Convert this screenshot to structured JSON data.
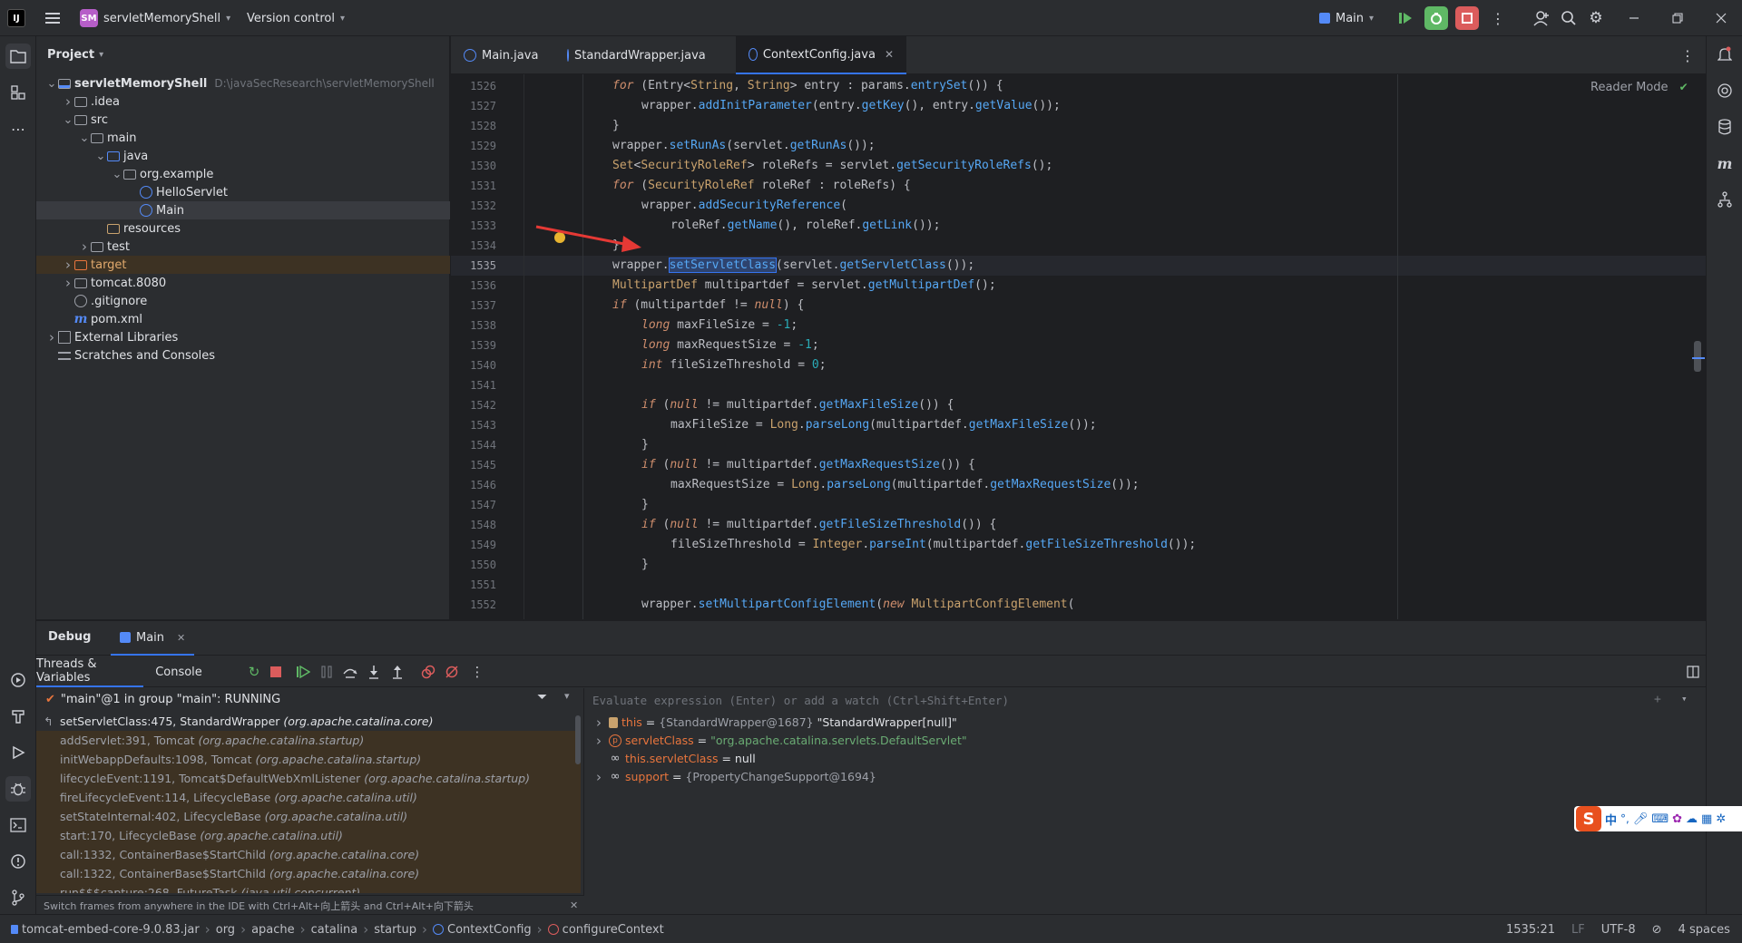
{
  "titlebar": {
    "app_badge": "SM",
    "project_name": "servletMemoryShell",
    "vcs_label": "Version control",
    "run_config": "Main"
  },
  "project_panel": {
    "title": "Project",
    "tree": [
      {
        "label": "servletMemoryShell",
        "path": "D:\\javaSecResearch\\servletMemoryShell",
        "depth": 0,
        "icon": "module-folder-icon",
        "expanded": true
      },
      {
        "label": ".idea",
        "depth": 1,
        "icon": "folder-icon",
        "expanded": false
      },
      {
        "label": "src",
        "depth": 1,
        "icon": "folder-icon",
        "expanded": true
      },
      {
        "label": "main",
        "depth": 2,
        "icon": "folder-icon",
        "expanded": true
      },
      {
        "label": "java",
        "depth": 3,
        "icon": "source-folder-icon",
        "expanded": true
      },
      {
        "label": "org.example",
        "depth": 4,
        "icon": "package-icon",
        "expanded": true
      },
      {
        "label": "HelloServlet",
        "depth": 5,
        "icon": "class-icon"
      },
      {
        "label": "Main",
        "depth": 5,
        "icon": "class-icon",
        "selected": true
      },
      {
        "label": "resources",
        "depth": 3,
        "icon": "resources-folder-icon"
      },
      {
        "label": "test",
        "depth": 2,
        "icon": "folder-icon",
        "expanded": false
      },
      {
        "label": "target",
        "depth": 1,
        "icon": "excluded-folder-icon",
        "expanded": false,
        "highlight": true
      },
      {
        "label": "tomcat.8080",
        "depth": 1,
        "icon": "folder-icon",
        "expanded": false
      },
      {
        "label": ".gitignore",
        "depth": 1,
        "icon": "ignore-file-icon"
      },
      {
        "label": "pom.xml",
        "depth": 1,
        "icon": "maven-icon"
      },
      {
        "label": "External Libraries",
        "depth": 0,
        "icon": "libraries-icon",
        "expanded": false
      },
      {
        "label": "Scratches and Consoles",
        "depth": 0,
        "icon": "scratches-icon"
      }
    ]
  },
  "editor": {
    "tabs": [
      {
        "label": "Main.java",
        "active": false
      },
      {
        "label": "StandardWrapper.java",
        "active": false
      },
      {
        "label": "ContextConfig.java",
        "active": true
      }
    ],
    "reader_mode": "Reader Mode",
    "lines": [
      {
        "n": "1526",
        "indent": 0
      },
      {
        "n": "1527",
        "indent": 1
      },
      {
        "n": "1528",
        "indent": 0
      },
      {
        "n": "1529",
        "indent": 0
      },
      {
        "n": "1530",
        "indent": 0
      },
      {
        "n": "1531",
        "indent": 0
      },
      {
        "n": "1532",
        "indent": 1
      },
      {
        "n": "1533",
        "indent": 2
      },
      {
        "n": "1534",
        "indent": 0
      },
      {
        "n": "1535",
        "indent": 0,
        "current": true
      },
      {
        "n": "1536",
        "indent": 0
      },
      {
        "n": "1537",
        "indent": 0
      },
      {
        "n": "1538",
        "indent": 1
      },
      {
        "n": "1539",
        "indent": 1
      },
      {
        "n": "1540",
        "indent": 1
      },
      {
        "n": "1541",
        "indent": 0
      },
      {
        "n": "1542",
        "indent": 1
      },
      {
        "n": "1543",
        "indent": 2
      },
      {
        "n": "1544",
        "indent": 1
      },
      {
        "n": "1545",
        "indent": 1
      },
      {
        "n": "1546",
        "indent": 2
      },
      {
        "n": "1547",
        "indent": 1
      },
      {
        "n": "1548",
        "indent": 1
      },
      {
        "n": "1549",
        "indent": 2
      },
      {
        "n": "1550",
        "indent": 1
      },
      {
        "n": "1551",
        "indent": 0
      },
      {
        "n": "1552",
        "indent": 1
      }
    ],
    "code": [
      [
        [
          "kwi",
          "for"
        ],
        [
          "ty",
          " (Entry<"
        ],
        [
          "cls",
          "String"
        ],
        [
          "ty",
          ", "
        ],
        [
          "cls",
          "String"
        ],
        [
          "ty",
          "> entry : params."
        ],
        [
          "fn",
          "entrySet"
        ],
        [
          "ty",
          "()) {"
        ]
      ],
      [
        [
          "ty",
          "wrapper."
        ],
        [
          "fn",
          "addInitParameter"
        ],
        [
          "ty",
          "(entry."
        ],
        [
          "fn",
          "getKey"
        ],
        [
          "ty",
          "(), entry."
        ],
        [
          "fn",
          "getValue"
        ],
        [
          "ty",
          "());"
        ]
      ],
      [
        [
          "ty",
          "}"
        ]
      ],
      [
        [
          "ty",
          "wrapper."
        ],
        [
          "fn",
          "setRunAs"
        ],
        [
          "ty",
          "(servlet."
        ],
        [
          "fn",
          "getRunAs"
        ],
        [
          "ty",
          "());"
        ]
      ],
      [
        [
          "cls",
          "Set"
        ],
        [
          "ty",
          "<"
        ],
        [
          "cls",
          "SecurityRoleRef"
        ],
        [
          "ty",
          "> roleRefs = servlet."
        ],
        [
          "fn",
          "getSecurityRoleRefs"
        ],
        [
          "ty",
          "();"
        ]
      ],
      [
        [
          "kwi",
          "for"
        ],
        [
          "ty",
          " ("
        ],
        [
          "cls",
          "SecurityRoleRef"
        ],
        [
          "ty",
          " roleRef : roleRefs) {"
        ]
      ],
      [
        [
          "ty",
          "wrapper."
        ],
        [
          "fn",
          "addSecurityReference"
        ],
        [
          "ty",
          "("
        ]
      ],
      [
        [
          "ty",
          "roleRef."
        ],
        [
          "fn",
          "getName"
        ],
        [
          "ty",
          "(), roleRef."
        ],
        [
          "fn",
          "getLink"
        ],
        [
          "ty",
          "());"
        ]
      ],
      [
        [
          "ty",
          "}"
        ]
      ],
      [
        [
          "ty",
          "wrapper."
        ],
        [
          "fn",
          "setServletClass"
        ],
        [
          "ty",
          "(servlet."
        ],
        [
          "fn",
          "getServletClass"
        ],
        [
          "ty",
          "());"
        ]
      ],
      [
        [
          "cls",
          "MultipartDef"
        ],
        [
          "ty",
          " multipartdef = servlet."
        ],
        [
          "fn",
          "getMultipartDef"
        ],
        [
          "ty",
          "();"
        ]
      ],
      [
        [
          "kwi",
          "if"
        ],
        [
          "ty",
          " (multipartdef != "
        ],
        [
          "kwi",
          "null"
        ],
        [
          "ty",
          ") {"
        ]
      ],
      [
        [
          "kwi",
          "long"
        ],
        [
          "ty",
          " maxFileSize = "
        ],
        [
          "num",
          "-1"
        ],
        [
          "ty",
          ";"
        ]
      ],
      [
        [
          "kwi",
          "long"
        ],
        [
          "ty",
          " maxRequestSize = "
        ],
        [
          "num",
          "-1"
        ],
        [
          "ty",
          ";"
        ]
      ],
      [
        [
          "kwi",
          "int"
        ],
        [
          "ty",
          " fileSizeThreshold = "
        ],
        [
          "num",
          "0"
        ],
        [
          "ty",
          ";"
        ]
      ],
      [],
      [
        [
          "kwi",
          "if"
        ],
        [
          "ty",
          " ("
        ],
        [
          "kwi",
          "null"
        ],
        [
          "ty",
          " != multipartdef."
        ],
        [
          "fn",
          "getMaxFileSize"
        ],
        [
          "ty",
          "()) {"
        ]
      ],
      [
        [
          "ty",
          "maxFileSize = "
        ],
        [
          "cls",
          "Long"
        ],
        [
          "ty",
          "."
        ],
        [
          "fn",
          "parseLong"
        ],
        [
          "ty",
          "(multipartdef."
        ],
        [
          "fn",
          "getMaxFileSize"
        ],
        [
          "ty",
          "());"
        ]
      ],
      [
        [
          "ty",
          "}"
        ]
      ],
      [
        [
          "kwi",
          "if"
        ],
        [
          "ty",
          " ("
        ],
        [
          "kwi",
          "null"
        ],
        [
          "ty",
          " != multipartdef."
        ],
        [
          "fn",
          "getMaxRequestSize"
        ],
        [
          "ty",
          "()) {"
        ]
      ],
      [
        [
          "ty",
          "maxRequestSize = "
        ],
        [
          "cls",
          "Long"
        ],
        [
          "ty",
          "."
        ],
        [
          "fn",
          "parseLong"
        ],
        [
          "ty",
          "(multipartdef."
        ],
        [
          "fn",
          "getMaxRequestSize"
        ],
        [
          "ty",
          "());"
        ]
      ],
      [
        [
          "ty",
          "}"
        ]
      ],
      [
        [
          "kwi",
          "if"
        ],
        [
          "ty",
          " ("
        ],
        [
          "kwi",
          "null"
        ],
        [
          "ty",
          " != multipartdef."
        ],
        [
          "fn",
          "getFileSizeThreshold"
        ],
        [
          "ty",
          "()) {"
        ]
      ],
      [
        [
          "ty",
          "fileSizeThreshold = "
        ],
        [
          "cls",
          "Integer"
        ],
        [
          "ty",
          "."
        ],
        [
          "fn",
          "parseInt"
        ],
        [
          "ty",
          "(multipartdef."
        ],
        [
          "fn",
          "getFileSizeThreshold"
        ],
        [
          "ty",
          "());"
        ]
      ],
      [
        [
          "ty",
          "}"
        ]
      ],
      [],
      [
        [
          "ty",
          "wrapper."
        ],
        [
          "fn",
          "setMultipartConfigElement"
        ],
        [
          "ty",
          "("
        ],
        [
          "kwi",
          "new"
        ],
        [
          "ty",
          " "
        ],
        [
          "cls",
          "MultipartConfigElement"
        ],
        [
          "ty",
          "("
        ]
      ]
    ]
  },
  "debug": {
    "title": "Debug",
    "session_tab": "Main",
    "subtabs": [
      "Threads & Variables",
      "Console"
    ],
    "thread": "\"main\"@1 in group \"main\": RUNNING",
    "frames": [
      {
        "method": "setServletClass:475, StandardWrapper",
        "pkg": "(org.apache.catalina.core)",
        "current": true
      },
      {
        "method": "addServlet:391, Tomcat",
        "pkg": "(org.apache.catalina.startup)"
      },
      {
        "method": "initWebappDefaults:1098, Tomcat",
        "pkg": "(org.apache.catalina.startup)"
      },
      {
        "method": "lifecycleEvent:1191, Tomcat$DefaultWebXmlListener",
        "pkg": "(org.apache.catalina.startup)"
      },
      {
        "method": "fireLifecycleEvent:114, LifecycleBase",
        "pkg": "(org.apache.catalina.util)"
      },
      {
        "method": "setStateInternal:402, LifecycleBase",
        "pkg": "(org.apache.catalina.util)"
      },
      {
        "method": "start:170, LifecycleBase",
        "pkg": "(org.apache.catalina.util)"
      },
      {
        "method": "call:1332, ContainerBase$StartChild",
        "pkg": "(org.apache.catalina.core)"
      },
      {
        "method": "call:1322, ContainerBase$StartChild",
        "pkg": "(org.apache.catalina.core)"
      },
      {
        "method": "run$$$capture:268, FutureTask",
        "pkg": "(java.util.concurrent)"
      }
    ],
    "frames_hint": "Switch frames from anywhere in the IDE with Ctrl+Alt+向上箭头 and Ctrl+Alt+向下箭头",
    "eval_placeholder": "Evaluate expression (Enter) or add a watch (Ctrl+Shift+Enter)",
    "variables": [
      {
        "name": "this",
        "eq": " = ",
        "type": "{StandardWrapper@1687}",
        "value": " \"StandardWrapper[null]\"",
        "expandable": true,
        "icon": "field-icon"
      },
      {
        "name": "servletClass",
        "eq": " = ",
        "type": "",
        "value": "\"org.apache.catalina.servlets.DefaultServlet\"",
        "expandable": true,
        "icon": "param-icon"
      },
      {
        "name": "this.servletClass",
        "eq": " = ",
        "type": "",
        "value": "null",
        "expandable": false,
        "icon": "watch-icon"
      },
      {
        "name": "support",
        "eq": " = ",
        "type": "{PropertyChangeSupport@1694}",
        "value": "",
        "expandable": true,
        "icon": "watch-icon"
      }
    ]
  },
  "statusbar": {
    "breadcrumbs": [
      "tomcat-embed-core-9.0.83.jar",
      "org",
      "apache",
      "catalina",
      "startup",
      "ContextConfig",
      "configureContext"
    ],
    "position": "1535:21",
    "line_sep": "LF",
    "encoding": "UTF-8",
    "indent": "4 spaces"
  },
  "ime": {
    "glyph": "中"
  },
  "colors": {
    "accent": "#3574f0",
    "keyword": "#cf8e6d",
    "method": "#56a8f5",
    "run_green": "#5fb865",
    "stop_red": "#db5c5c",
    "arrow_red": "#e53935"
  }
}
